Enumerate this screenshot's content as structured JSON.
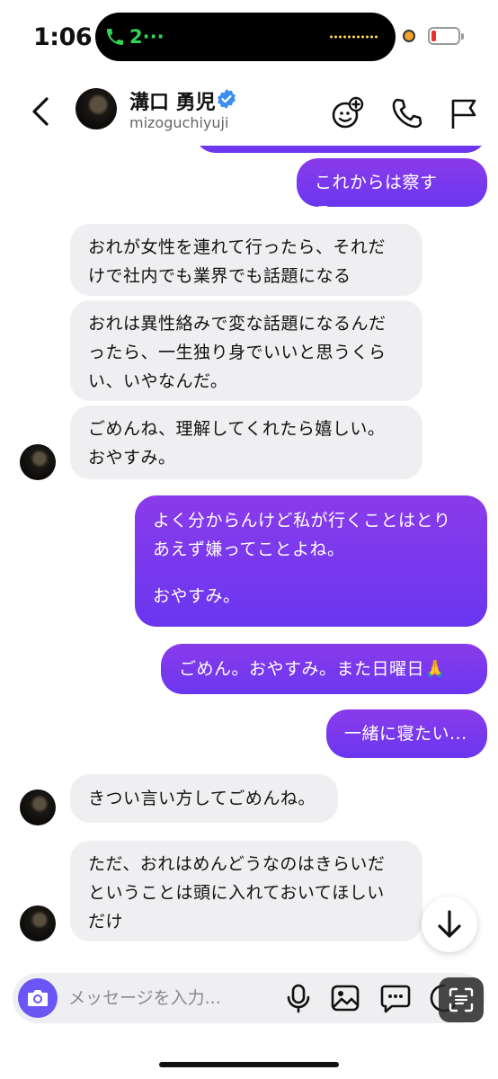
{
  "status_bar": {
    "time": "1:06",
    "call_indicator": "2···",
    "battery_color": "#e5322d"
  },
  "header": {
    "name": "溝口 勇児",
    "handle": "mizoguchiyuji",
    "verified": true,
    "icons": [
      "back-chevron-icon",
      "add-person-icon",
      "phone-icon",
      "flag-icon"
    ]
  },
  "messages": [
    {
      "side": "out",
      "lines": [
        "これからは察する。"
      ]
    },
    {
      "side": "in",
      "lines": [
        "おれが女性を連れて行ったら、それだ",
        "けで社内でも業界でも話題になる"
      ]
    },
    {
      "side": "in",
      "lines": [
        "おれは異性絡みで変な話題になるんだ",
        "ったら、一生独り身でいいと思うくら",
        "い、いやなんだ。"
      ]
    },
    {
      "side": "in",
      "lines": [
        "ごめんね、理解してくれたら嬉しい。",
        "おやすみ。"
      ]
    },
    {
      "side": "out",
      "lines": [
        "よく分からんけど私が行くことはとり",
        "あえず嫌ってことよね。",
        "",
        "おやすみ。"
      ]
    },
    {
      "side": "out",
      "lines": [
        "ごめん。おやすみ。また日曜日🙏"
      ]
    },
    {
      "side": "out",
      "lines": [
        "一緒に寝たい..."
      ]
    },
    {
      "side": "in",
      "lines": [
        "きつい言い方してごめんね。"
      ]
    },
    {
      "side": "in",
      "lines": [
        "ただ、おれはめんどうなのはきらいだ",
        "ということは頭に入れておいてほしい",
        "だけ"
      ]
    }
  ],
  "composer": {
    "placeholder": "メッセージを入力...",
    "icons": [
      "camera-icon",
      "microphone-icon",
      "image-icon",
      "chat-bubble-icon",
      "sticker-icon",
      "scan-text-icon"
    ]
  },
  "colors": {
    "accent": "#6b55f5",
    "bubble_out": "#7a38ee",
    "bubble_in": "#efeff1"
  }
}
